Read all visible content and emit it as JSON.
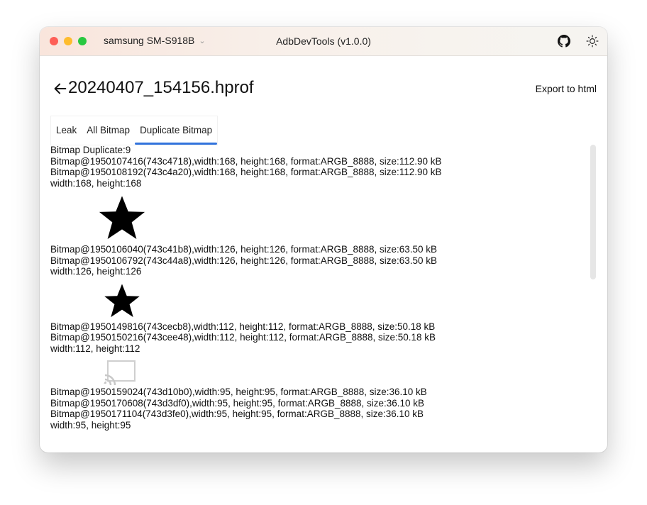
{
  "titlebar": {
    "device": "samsung SM-S918B",
    "app_title": "AdbDevTools (v1.0.0)"
  },
  "header": {
    "filename": "20240407_154156.hprof",
    "export_label": "Export to html"
  },
  "tabs": [
    {
      "label": "Leak"
    },
    {
      "label": "All Bitmap"
    },
    {
      "label": "Duplicate Bitmap"
    }
  ],
  "active_tab": "Duplicate Bitmap",
  "content": {
    "summary": "Bitmap Duplicate:9",
    "groups": [
      {
        "entries": [
          "Bitmap@1950107416(743c4718),width:168, height:168, format:ARGB_8888, size:112.90 kB",
          "Bitmap@1950108192(743c4a20),width:168, height:168, format:ARGB_8888, size:112.90 kB"
        ],
        "dims": "width:168, height:168",
        "preview": "star-icon"
      },
      {
        "entries": [
          "Bitmap@1950106040(743c41b8),width:126, height:126, format:ARGB_8888, size:63.50 kB",
          "Bitmap@1950106792(743c44a8),width:126, height:126, format:ARGB_8888, size:63.50 kB"
        ],
        "dims": "width:126, height:126",
        "preview": "star-icon"
      },
      {
        "entries": [
          "Bitmap@1950149816(743cecb8),width:112, height:112, format:ARGB_8888, size:50.18 kB",
          "Bitmap@1950150216(743cee48),width:112, height:112, format:ARGB_8888, size:50.18 kB"
        ],
        "dims": "width:112, height:112",
        "preview": "cast-icon"
      },
      {
        "entries": [
          "Bitmap@1950159024(743d10b0),width:95, height:95, format:ARGB_8888, size:36.10 kB",
          "Bitmap@1950170608(743d3df0),width:95, height:95, format:ARGB_8888, size:36.10 kB",
          "Bitmap@1950171104(743d3fe0),width:95, height:95, format:ARGB_8888, size:36.10 kB"
        ],
        "dims": "width:95, height:95"
      }
    ]
  },
  "colors": {
    "accent": "#3273dc",
    "close": "#fe5f57",
    "minimize": "#febc2e",
    "maximize": "#28c840"
  }
}
